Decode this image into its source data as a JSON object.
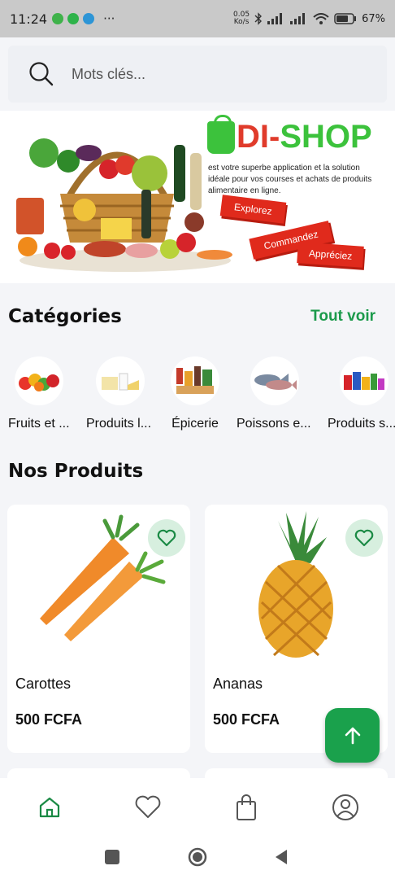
{
  "status_bar": {
    "time": "11:24",
    "more": "···",
    "net_speed_value": "0.05",
    "net_speed_unit": "Ko/s",
    "battery": "67%"
  },
  "search": {
    "placeholder": "Mots clés..."
  },
  "banner": {
    "brand_prefix": "DI-",
    "brand_suffix": "SHOP",
    "tagline": "est votre superbe application et la solution idéale pour vos courses et achats de produits alimentaire en ligne.",
    "buttons": [
      "Explorez",
      "Commandez",
      "Appréciez"
    ]
  },
  "categories": {
    "title": "Catégories",
    "see_all": "Tout voir",
    "items": [
      {
        "label": "Fruits et ..."
      },
      {
        "label": "Produits l..."
      },
      {
        "label": "Épicerie"
      },
      {
        "label": "Poissons e..."
      },
      {
        "label": "Produits s..."
      }
    ]
  },
  "products": {
    "title": "Nos Produits",
    "items": [
      {
        "name": "Carottes",
        "price": "500 FCFA"
      },
      {
        "name": "Ananas",
        "price": "500 FCFA"
      }
    ]
  },
  "colors": {
    "accent_green": "#1aa14c",
    "fav_bg": "#d7efdf",
    "banner_red": "#e02a1c"
  },
  "icons": {
    "search": "search-icon",
    "favorite": "heart-icon",
    "scroll_top": "arrow-up-icon",
    "nav": [
      "home-icon",
      "heart-icon",
      "shopping-bag-icon",
      "user-icon"
    ]
  }
}
